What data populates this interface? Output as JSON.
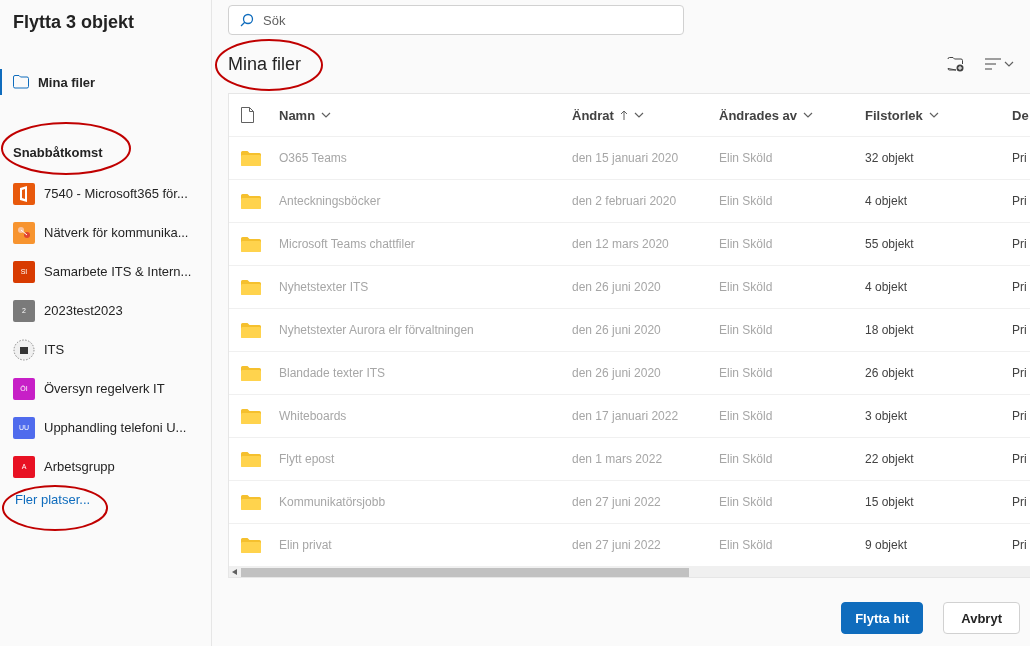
{
  "dialog": {
    "title": "Flytta 3 objekt"
  },
  "sidebar": {
    "current": {
      "label": "Mina filer",
      "selected": true
    },
    "section_title": "Snabbåtkomst",
    "items": [
      {
        "label": "7540 - Microsoft365 för...",
        "kind": "office",
        "color": "#e8590c"
      },
      {
        "label": "Nätverk för kommunika...",
        "kind": "graphic",
        "color": "#f7942f"
      },
      {
        "label": "Samarbete ITS & Intern...",
        "kind": "initials",
        "initials": "SI",
        "color": "#d83b01"
      },
      {
        "label": "2023test2023",
        "kind": "initials",
        "initials": "2",
        "color": "#7a7a7a"
      },
      {
        "label": "ITS",
        "kind": "emblem",
        "color": "#f0f0f0"
      },
      {
        "label": "Översyn regelverk IT",
        "kind": "initials",
        "initials": "ÖI",
        "color": "#c71fc7"
      },
      {
        "label": "Upphandling telefoni U...",
        "kind": "initials",
        "initials": "UU",
        "color": "#4f6bed"
      },
      {
        "label": "Arbetsgrupp",
        "kind": "initials",
        "initials": "A",
        "color": "#e81123"
      }
    ],
    "more_link": "Fler platser..."
  },
  "search": {
    "placeholder": "Sök"
  },
  "breadcrumb": "Mina filer",
  "table": {
    "columns": [
      {
        "label": "Namn",
        "sorted": false
      },
      {
        "label": "Ändrat",
        "sorted": true
      },
      {
        "label": "Ändrades av",
        "sorted": false
      },
      {
        "label": "Filstorlek",
        "sorted": false
      },
      {
        "label": "De"
      }
    ],
    "rows": [
      {
        "name": "O365 Teams",
        "modified": "den 15 januari 2020",
        "modified_by": "Elin Sköld",
        "size": "32 objekt",
        "column_5": "Pri"
      },
      {
        "name": "Anteckningsböcker",
        "modified": "den 2 februari 2020",
        "modified_by": "Elin Sköld",
        "size": "4 objekt",
        "column_5": "Pri"
      },
      {
        "name": "Microsoft Teams chattfiler",
        "modified": "den 12 mars 2020",
        "modified_by": "Elin Sköld",
        "size": "55 objekt",
        "column_5": "Pri"
      },
      {
        "name": "Nyhetstexter ITS",
        "modified": "den 26 juni 2020",
        "modified_by": "Elin Sköld",
        "size": "4 objekt",
        "column_5": "Pri"
      },
      {
        "name": "Nyhetstexter Aurora elr förvaltningen",
        "modified": "den 26 juni 2020",
        "modified_by": "Elin Sköld",
        "size": "18 objekt",
        "column_5": "Pri"
      },
      {
        "name": "Blandade texter ITS",
        "modified": "den 26 juni 2020",
        "modified_by": "Elin Sköld",
        "size": "26 objekt",
        "column_5": "Pri"
      },
      {
        "name": "Whiteboards",
        "modified": "den 17 januari 2022",
        "modified_by": "Elin Sköld",
        "size": "3 objekt",
        "column_5": "Pri"
      },
      {
        "name": "Flytt epost",
        "modified": "den 1 mars 2022",
        "modified_by": "Elin Sköld",
        "size": "22 objekt",
        "column_5": "Pri"
      },
      {
        "name": "Kommunikatörsjobb",
        "modified": "den 27 juni 2022",
        "modified_by": "Elin Sköld",
        "size": "15 objekt",
        "column_5": "Pri"
      },
      {
        "name": "Elin privat",
        "modified": "den 27 juni 2022",
        "modified_by": "Elin Sköld",
        "size": "9 objekt",
        "column_5": "Pri"
      }
    ]
  },
  "buttons": [
    {
      "label": "Flytta hit",
      "kind": "primary"
    },
    {
      "label": "Avbryt",
      "kind": "secondary"
    }
  ]
}
